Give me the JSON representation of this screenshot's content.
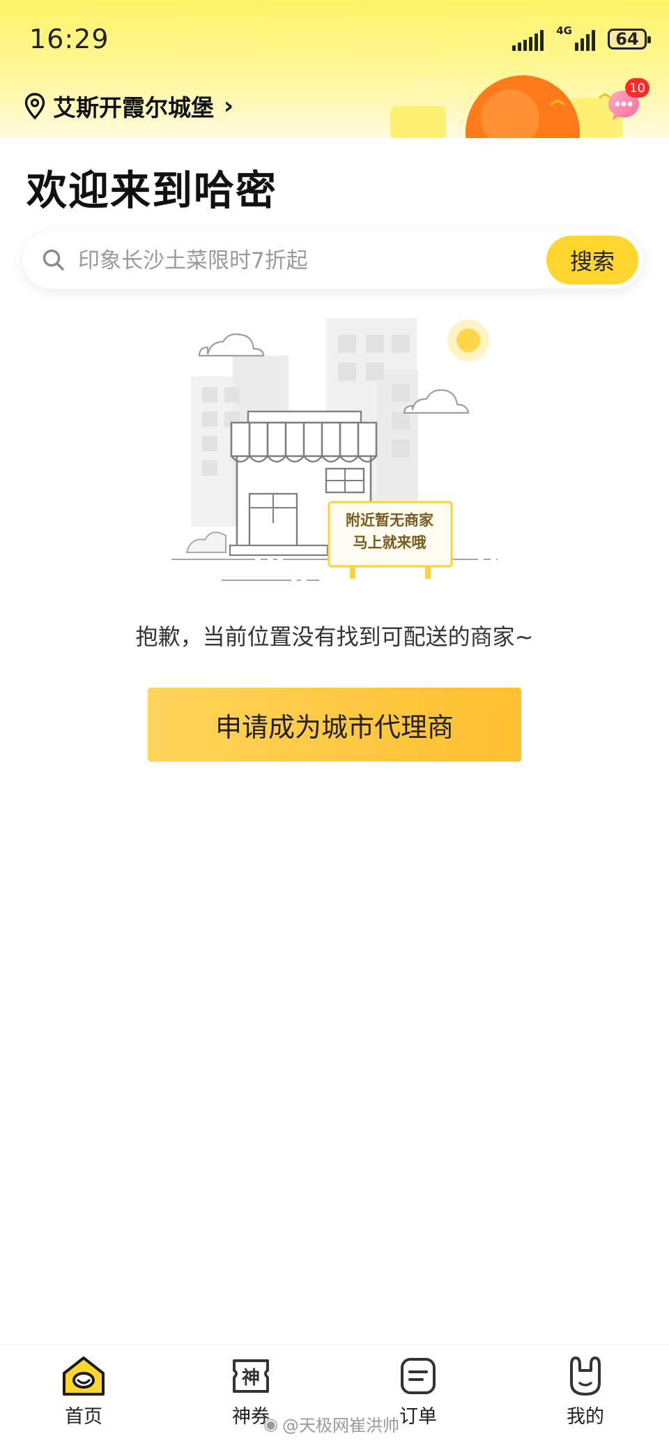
{
  "status_bar": {
    "time": "16:29",
    "network": "4G",
    "battery": "64"
  },
  "header": {
    "location": "艾斯开霞尔城堡",
    "message_badge": "10"
  },
  "welcome_title": "欢迎来到哈密",
  "search": {
    "placeholder": "印象长沙土菜限时7折起",
    "button_label": "搜索"
  },
  "empty_state": {
    "sign_line1": "附近暂无商家",
    "sign_line2": "马上就来哦",
    "message": "抱歉，当前位置没有找到可配送的商家~",
    "apply_button": "申请成为城市代理商"
  },
  "bottom_nav": {
    "items": [
      {
        "label": "首页",
        "icon": "home-icon",
        "active": true
      },
      {
        "label": "神券",
        "icon": "coupon-icon",
        "active": false
      },
      {
        "label": "订单",
        "icon": "order-icon",
        "active": false
      },
      {
        "label": "我的",
        "icon": "profile-icon",
        "active": false
      }
    ]
  },
  "watermark": "@天极网崔洪帅",
  "colors": {
    "accent": "#ffd52e",
    "badge": "#ff2a2a",
    "sign_text": "#7a5a1e"
  }
}
